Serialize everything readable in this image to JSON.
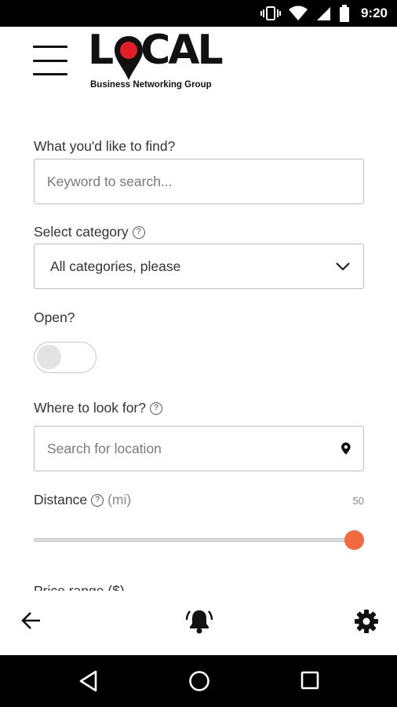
{
  "status_bar": {
    "time": "9:20"
  },
  "header": {
    "logo_word": "LOCAL",
    "logo_tagline": "Business Networking Group",
    "brand_color": "#e41e26"
  },
  "form": {
    "keyword": {
      "label": "What you'd like to find?",
      "placeholder": "Keyword to search..."
    },
    "category": {
      "label": "Select category",
      "value": "All categories, please"
    },
    "open": {
      "label": "Open?",
      "checked": false
    },
    "location": {
      "label": "Where to look for?",
      "placeholder": "Search for location"
    },
    "distance": {
      "label": "Distance",
      "unit": "(mi)",
      "value": "50",
      "fraction": 1.0
    },
    "price": {
      "label": "Price range ($)"
    }
  },
  "accent_color": "#f26a3d",
  "icons": {
    "status": [
      "vibrate-icon",
      "wifi-icon",
      "signal-icon",
      "battery-icon"
    ],
    "app_bar": [
      "back-arrow-icon",
      "bell-ringing-icon",
      "gear-icon"
    ],
    "nav": [
      "nav-back-icon",
      "nav-home-icon",
      "nav-recents-icon"
    ]
  }
}
